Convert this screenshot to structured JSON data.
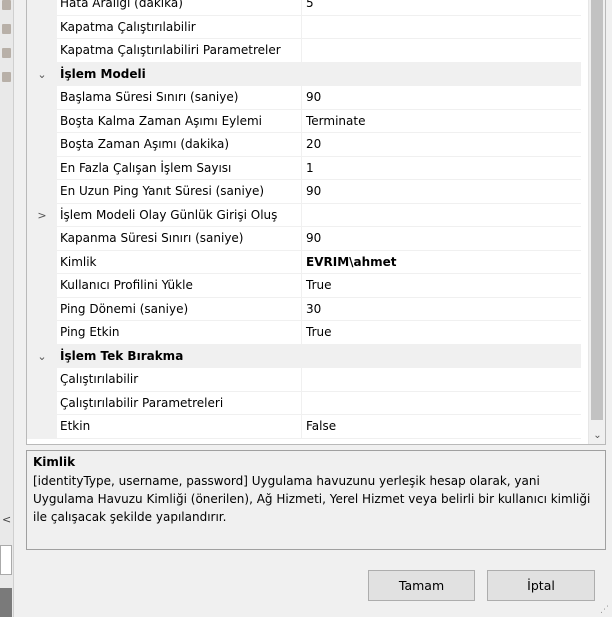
{
  "properties": {
    "rows": [
      {
        "type": "prop",
        "name": "Hata Aralığı (dakika)",
        "value": "5"
      },
      {
        "type": "prop",
        "name": "Kapatma Çalıştırılabilir",
        "value": ""
      },
      {
        "type": "prop",
        "name": "Kapatma Çalıştırılabiliri Parametreler",
        "value": ""
      },
      {
        "type": "cat",
        "expander": "⌄",
        "name": "İşlem Modeli",
        "value": ""
      },
      {
        "type": "prop",
        "name": "Başlama Süresi Sınırı (saniye)",
        "value": "90"
      },
      {
        "type": "prop",
        "name": "Boşta Kalma Zaman Aşımı Eylemi",
        "value": "Terminate"
      },
      {
        "type": "prop",
        "name": "Boşta Zaman Aşımı (dakika)",
        "value": "20"
      },
      {
        "type": "prop",
        "name": "En Fazla Çalışan İşlem Sayısı",
        "value": "1"
      },
      {
        "type": "prop",
        "name": "En Uzun Ping Yanıt Süresi (saniye)",
        "value": "90"
      },
      {
        "type": "prop",
        "expander": ">",
        "name": "İşlem Modeli Olay Günlük Girişi Oluş",
        "value": ""
      },
      {
        "type": "prop",
        "name": "Kapanma Süresi Sınırı (saniye)",
        "value": "90"
      },
      {
        "type": "prop",
        "name": "Kimlik",
        "value": "EVRIM\\ahmet",
        "bold": true
      },
      {
        "type": "prop",
        "name": "Kullanıcı Profilini Yükle",
        "value": "True"
      },
      {
        "type": "prop",
        "name": "Ping Dönemi (saniye)",
        "value": "30"
      },
      {
        "type": "prop",
        "name": "Ping Etkin",
        "value": "True"
      },
      {
        "type": "cat",
        "expander": "⌄",
        "name": "İşlem Tek Bırakma",
        "value": ""
      },
      {
        "type": "prop",
        "name": "Çalıştırılabilir",
        "value": ""
      },
      {
        "type": "prop",
        "name": "Çalıştırılabilir Parametreleri",
        "value": ""
      },
      {
        "type": "prop",
        "name": "Etkin",
        "value": "False"
      }
    ]
  },
  "description": {
    "title": "Kimlik",
    "text": "[identityType, username, password] Uygulama havuzunu yerleşik hesap olarak, yani Uygulama Havuzu Kimliği (önerilen), Ağ Hizmeti, Yerel Hizmet veya belirli bir kullanıcı kimliği ile çalışacak şekilde yapılandırır."
  },
  "buttons": {
    "ok": "Tamam",
    "cancel": "İptal"
  },
  "icons": {
    "scroll_down": "chevron-down-icon",
    "expand": "chevron-right-icon",
    "collapse": "chevron-down-icon"
  }
}
